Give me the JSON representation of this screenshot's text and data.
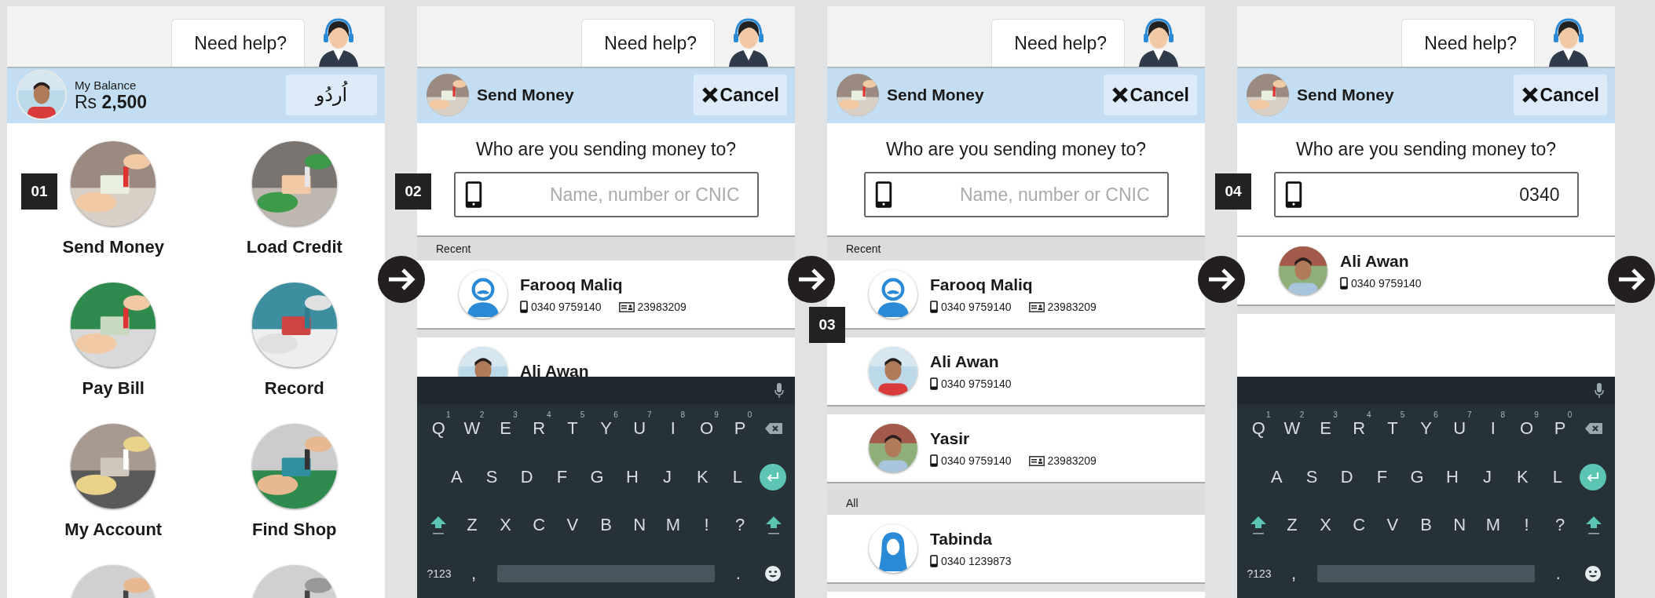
{
  "screens": [
    {
      "kind": "home",
      "help_label": "Need help?",
      "balance_label": "My Balance",
      "balance_amount": "Rs **2,500**",
      "language_button": "اُردُو",
      "tiles": [
        {
          "label": "Send Money",
          "kind": "picture",
          "step": "01"
        },
        {
          "label": "Load Credit",
          "kind": "picture"
        },
        {
          "label": "Pay Bill",
          "kind": "picture"
        },
        {
          "label": "Record",
          "kind": "picture"
        },
        {
          "label": "My Account",
          "kind": "picture"
        },
        {
          "label": "Find Shop",
          "kind": "picture"
        },
        {
          "kind": "picture"
        },
        {
          "kind": "picture"
        }
      ]
    },
    {
      "kind": "send",
      "help_label": "Need help?",
      "title": "Send Money",
      "cancel": "Cancel",
      "question": "Who are you sending money to?",
      "search": {
        "placeholder": "Name, number or CNIC",
        "step": "02"
      },
      "sections": [
        {
          "heading": "Recent",
          "contacts": [
            {
              "name": "Farooq Maliq",
              "phone": "0340 9759140",
              "cnic": "23983209",
              "kind": "man"
            },
            {
              "name": "Ali Awan"
            }
          ]
        }
      ],
      "keyboard": {
        "rows": [
          {
            "keys": [
              {
                "kind": "char",
                "label": "Q",
                "hint": "1"
              },
              {
                "kind": "char",
                "label": "W",
                "hint": "2"
              },
              {
                "kind": "char",
                "label": "E",
                "hint": "3"
              },
              {
                "kind": "char",
                "label": "R",
                "hint": "4"
              },
              {
                "kind": "char",
                "label": "T",
                "hint": "5"
              },
              {
                "kind": "char",
                "label": "Y",
                "hint": "6"
              },
              {
                "kind": "char",
                "label": "U",
                "hint": "7"
              },
              {
                "kind": "char",
                "label": "I",
                "hint": "8"
              },
              {
                "kind": "char",
                "label": "O",
                "hint": "9"
              },
              {
                "kind": "char",
                "label": "P",
                "hint": "0"
              },
              {
                "kind": "backspace"
              }
            ]
          },
          {
            "keys": [
              {
                "kind": "char",
                "label": "A"
              },
              {
                "kind": "char",
                "label": "S"
              },
              {
                "kind": "char",
                "label": "D"
              },
              {
                "kind": "char",
                "label": "F"
              },
              {
                "kind": "char",
                "label": "G"
              },
              {
                "kind": "char",
                "label": "H"
              },
              {
                "kind": "char",
                "label": "J"
              },
              {
                "kind": "char",
                "label": "K"
              },
              {
                "kind": "char",
                "label": "L"
              },
              {
                "kind": "enter"
              }
            ]
          },
          {
            "keys": [
              {
                "kind": "shift"
              },
              {
                "kind": "char",
                "label": "Z"
              },
              {
                "kind": "char",
                "label": "X"
              },
              {
                "kind": "char",
                "label": "C"
              },
              {
                "kind": "char",
                "label": "V"
              },
              {
                "kind": "char",
                "label": "B"
              },
              {
                "kind": "char",
                "label": "N"
              },
              {
                "kind": "char",
                "label": "M"
              },
              {
                "kind": "char",
                "label": "!"
              },
              {
                "kind": "char",
                "label": "?"
              },
              {
                "kind": "shift"
              }
            ]
          },
          {
            "keys": [
              {
                "kind": "small",
                "label": "?123"
              },
              {
                "kind": "char",
                "label": ","
              },
              {
                "kind": "space"
              },
              {
                "kind": "char",
                "label": "."
              },
              {
                "kind": "emoji"
              }
            ]
          }
        ]
      }
    },
    {
      "kind": "send",
      "help_label": "Need help?",
      "title": "Send Money",
      "cancel": "Cancel",
      "question": "Who are you sending money to?",
      "search": {
        "placeholder": "Name, number or CNIC"
      },
      "sections": [
        {
          "heading": "Recent",
          "contacts": [
            {
              "name": "Farooq Maliq",
              "phone": "0340 9759140",
              "cnic": "23983209",
              "kind": "man",
              "step": "03"
            },
            {
              "name": "Ali Awan",
              "phone": "0340 9759140"
            },
            {
              "name": "Yasir",
              "phone": "0340 9759140",
              "cnic": "23983209"
            }
          ]
        },
        {
          "heading": "All",
          "contacts": [
            {
              "name": "Tabinda",
              "phone": "0340 1239873",
              "kind": "woman"
            }
          ]
        }
      ]
    },
    {
      "kind": "send",
      "help_label": "Need help?",
      "title": "Send Money",
      "cancel": "Cancel",
      "question": "Who are you sending money to?",
      "search": {
        "value": "0340",
        "step": "04"
      },
      "sections": [
        {
          "contacts": [
            {
              "name": "Ali Awan",
              "phone": "0340 9759140"
            }
          ]
        }
      ],
      "keyboard": {
        "rows": [
          {
            "keys": [
              {
                "kind": "char",
                "label": "Q",
                "hint": "1"
              },
              {
                "kind": "char",
                "label": "W",
                "hint": "2"
              },
              {
                "kind": "char",
                "label": "E",
                "hint": "3"
              },
              {
                "kind": "char",
                "label": "R",
                "hint": "4"
              },
              {
                "kind": "char",
                "label": "T",
                "hint": "5"
              },
              {
                "kind": "char",
                "label": "Y",
                "hint": "6"
              },
              {
                "kind": "char",
                "label": "U",
                "hint": "7"
              },
              {
                "kind": "char",
                "label": "I",
                "hint": "8"
              },
              {
                "kind": "char",
                "label": "O",
                "hint": "9"
              },
              {
                "kind": "char",
                "label": "P",
                "hint": "0"
              },
              {
                "kind": "backspace"
              }
            ]
          },
          {
            "keys": [
              {
                "kind": "char",
                "label": "A"
              },
              {
                "kind": "char",
                "label": "S"
              },
              {
                "kind": "char",
                "label": "D"
              },
              {
                "kind": "char",
                "label": "F"
              },
              {
                "kind": "char",
                "label": "G"
              },
              {
                "kind": "char",
                "label": "H"
              },
              {
                "kind": "char",
                "label": "J"
              },
              {
                "kind": "char",
                "label": "K"
              },
              {
                "kind": "char",
                "label": "L"
              },
              {
                "kind": "enter"
              }
            ]
          },
          {
            "keys": [
              {
                "kind": "shift"
              },
              {
                "kind": "char",
                "label": "Z"
              },
              {
                "kind": "char",
                "label": "X"
              },
              {
                "kind": "char",
                "label": "C"
              },
              {
                "kind": "char",
                "label": "V"
              },
              {
                "kind": "char",
                "label": "B"
              },
              {
                "kind": "char",
                "label": "N"
              },
              {
                "kind": "char",
                "label": "M"
              },
              {
                "kind": "char",
                "label": "!"
              },
              {
                "kind": "char",
                "label": "?"
              },
              {
                "kind": "shift"
              }
            ]
          },
          {
            "keys": [
              {
                "kind": "small",
                "label": "?123"
              },
              {
                "kind": "char",
                "label": ","
              },
              {
                "kind": "space"
              },
              {
                "kind": "char",
                "label": "."
              },
              {
                "kind": "emoji"
              }
            ]
          }
        ]
      }
    }
  ]
}
